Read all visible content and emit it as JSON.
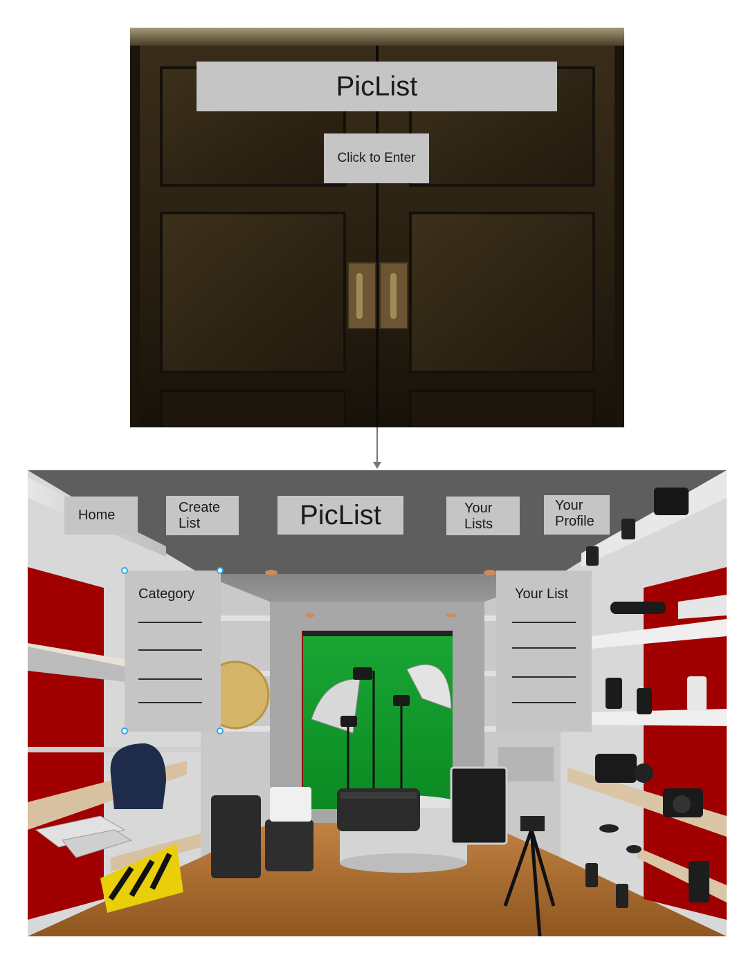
{
  "entry_screen": {
    "title": "PicList",
    "enter_button_label": "Click to Enter"
  },
  "studio_screen": {
    "nav": {
      "home_label": "Home",
      "create_list_line1": "Create",
      "create_list_line2": "List",
      "title": "PicList",
      "your_lists_line1": "Your",
      "your_lists_line2": "Lists",
      "your_profile_line1": "Your",
      "your_profile_line2": "Profile"
    },
    "category_panel": {
      "title": "Category"
    },
    "your_list_panel": {
      "title": "Your List"
    }
  },
  "colors": {
    "panel_gray": "#c5c5c5",
    "door_wood": "#2e2415",
    "studio_wall_red": "#a20000",
    "green_screen": "#14a02a",
    "wood_floor": "#b9772e",
    "selection_handle": "#2ba9e8"
  }
}
